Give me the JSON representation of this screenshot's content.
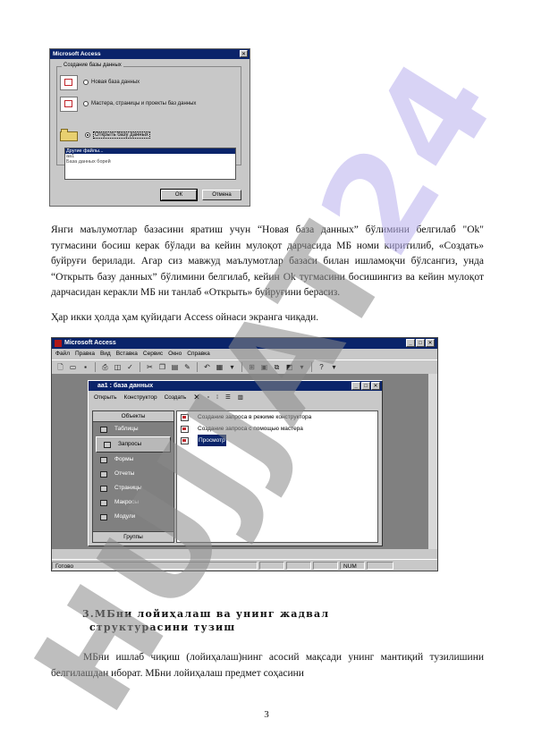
{
  "dialog": {
    "title": "Microsoft Access",
    "group_label": "Создание базы данных",
    "option_new": "Новая база данных",
    "option_wizard": "Мастера, страницы и проекты баз данных",
    "option_open": "Открыть базу данных",
    "files": [
      "Другие файлы...",
      "aa1",
      "База данных борей"
    ],
    "ok": "ОК",
    "cancel": "Отмена"
  },
  "paragraphs": {
    "p1": "Янги маълумотлар базасини яратиш учун “Новая база данных” бўлимини белгилаб \"Ok\" тугмасини босиш керак бўлади ва кейин мулоқот дарчасида МБ номи киритилиб, «Создать» буйруғи берилади. Агар сиз мавжуд маълумотлар базаси билан ишламоқчи бўлсангиз, унда “Открыть базу данных” бўлимини белгилаб, кейин Ok тугмасини босишингиз ва кейин мулоқот дарчасидан керакли МБ ни танлаб «Открыть» буйруғини берасиз.",
    "p2": "Ҳар икки ҳолда ҳам қуйидаги Access ойнаси экранга чиқади.",
    "p3": "МБни ишлаб чиқиш (лойиҳалаш)нинг асосий мақсади унинг мантиқий тузилишини белгилашдан иборат. МБни лойиҳалаш предмет соҳасини"
  },
  "access": {
    "title": "Microsoft Access",
    "menu": [
      "Файл",
      "Правка",
      "Вид",
      "Вставка",
      "Сервис",
      "Окно",
      "Справка"
    ],
    "status": "Готово",
    "num": "NUM"
  },
  "dbwin": {
    "title": "aa1 : база данных",
    "open": "Открыть",
    "design": "Конструктор",
    "create": "Создать",
    "objects_header": "Объекты",
    "objects": [
      "Таблицы",
      "Запросы",
      "Формы",
      "Отчеты",
      "Страницы",
      "Макросы",
      "Модули"
    ],
    "groups": "Группы",
    "queries": [
      "Создание запроса в режиме конструктора",
      "Создание запроса с помощью мастера",
      "Просмотр"
    ]
  },
  "heading": {
    "line1": "3.МБни лойиҳалаш ва унинг жадвал",
    "line2": "структурасини тузиш"
  },
  "page_number": "3",
  "watermark": {
    "part_a": "HUJJAT",
    "part_b": "24"
  }
}
